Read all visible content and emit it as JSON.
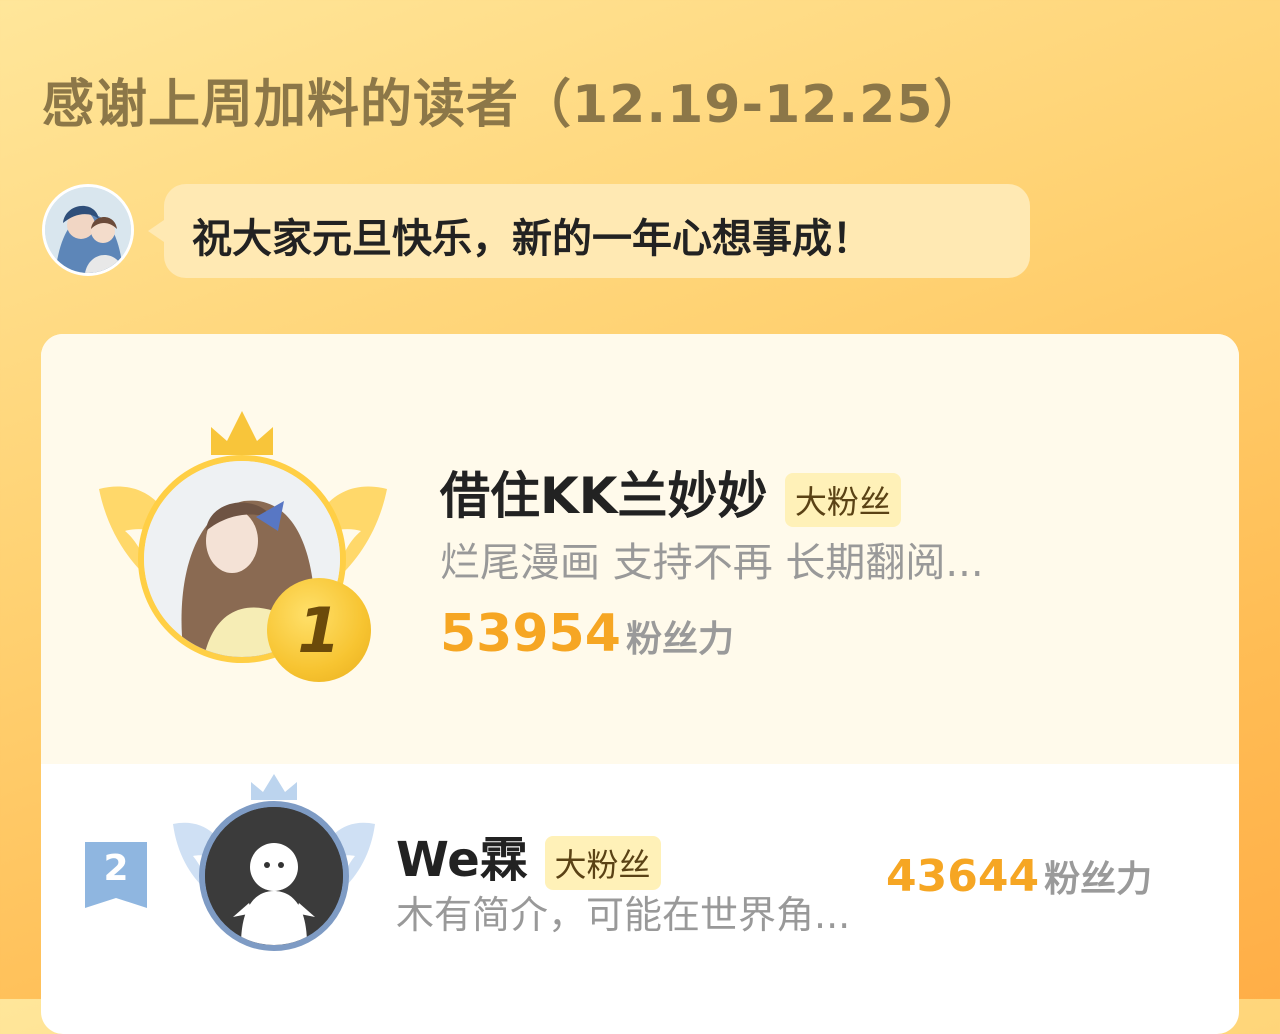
{
  "header": {
    "title": "感谢上周加料的读者（12.19-12.25）"
  },
  "author_message": {
    "text": "祝大家元旦快乐，新的一年心想事成！"
  },
  "ranking": [
    {
      "rank": "1",
      "name": "借住KK兰妙妙",
      "badge": "大粉丝",
      "description": "烂尾漫画 支持不再 长期翻阅...",
      "score": "53954",
      "score_unit": "粉丝力"
    },
    {
      "rank": "2",
      "name": "We霖",
      "badge": "大粉丝",
      "description": "木有简介，可能在世界角...",
      "score": "43644",
      "score_unit": "粉丝力"
    }
  ],
  "colors": {
    "score": "#f6a623",
    "title": "#8c7748",
    "gold_badge": "#f7c431",
    "silver_badge": "#7ea7d8"
  },
  "icons": {
    "first_place": "gold-crown-wings-icon",
    "second_place": "silver-crown-wings-icon",
    "rank_flag": "rank-ribbon-icon"
  }
}
